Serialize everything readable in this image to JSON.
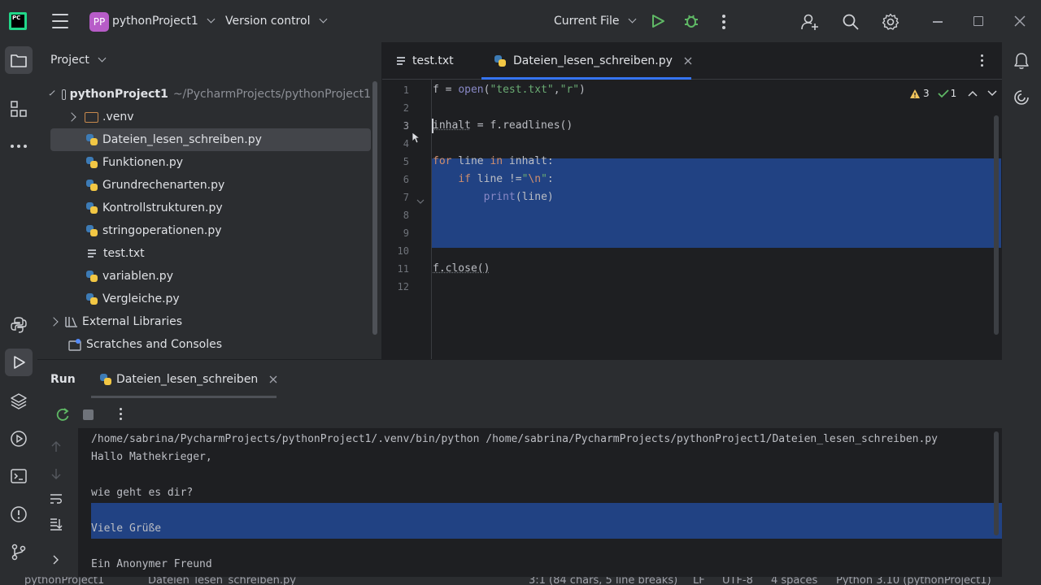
{
  "titlebar": {
    "logo_text": "PC",
    "project_badge": "PP",
    "project_name": "pythonProject1",
    "vcs_label": "Version control",
    "run_config": "Current File"
  },
  "project_panel": {
    "title": "Project",
    "root_name": "pythonProject1",
    "root_path": "~/PycharmProjects/pythonProject1",
    "items": [
      {
        "label": ".venv",
        "kind": "folder"
      },
      {
        "label": "Dateien_lesen_schreiben.py",
        "kind": "py",
        "selected": true
      },
      {
        "label": "Funktionen.py",
        "kind": "py"
      },
      {
        "label": "Grundrechenarten.py",
        "kind": "py"
      },
      {
        "label": "Kontrollstrukturen.py",
        "kind": "py"
      },
      {
        "label": "stringoperationen.py",
        "kind": "py"
      },
      {
        "label": "test.txt",
        "kind": "txt"
      },
      {
        "label": "variablen.py",
        "kind": "py"
      },
      {
        "label": "Vergleiche.py",
        "kind": "py"
      }
    ],
    "external_libraries": "External Libraries",
    "scratches": "Scratches and Consoles"
  },
  "editor": {
    "tabs": [
      {
        "label": "test.txt"
      },
      {
        "label": "Dateien_lesen_schreiben.py",
        "active": true
      }
    ],
    "warnings": "3",
    "checks": "1",
    "line_numbers": [
      "1",
      "2",
      "3",
      "4",
      "5",
      "6",
      "7",
      "8",
      "9",
      "10",
      "11",
      "12"
    ],
    "current_line": "3"
  },
  "run_panel": {
    "title": "Run",
    "tab_label": "Dateien_lesen_schreiben",
    "output": [
      "/home/sabrina/PycharmProjects/pythonProject1/.venv/bin/python /home/sabrina/PycharmProjects/pythonProject1/Dateien_lesen_schreiben.py",
      "Hallo Mathekrieger,",
      "",
      "wie geht es dir?",
      "",
      "Viele Grüße",
      "",
      "Ein Anonymer Freund"
    ]
  },
  "statusbar": {
    "breadcrumb_project": "pythonProject1",
    "breadcrumb_file": "Dateien_lesen_schreiben.py",
    "position": "3:1 (84 chars, 5 line breaks)",
    "line_ending": "LF",
    "encoding": "UTF-8",
    "indent": "4 spaces",
    "interpreter": "Python 3.10 (pythonProject1)"
  },
  "colors": {
    "selection": "#214283",
    "accent": "#3574f0",
    "run_green": "#5fb865",
    "debug_green": "#5fb865",
    "project_badge": "#b75cc8"
  }
}
